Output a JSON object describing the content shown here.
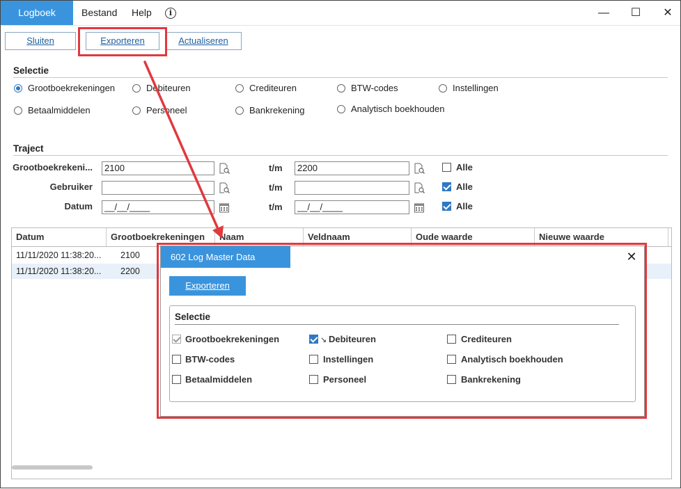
{
  "window": {
    "app_tab": "Logboek",
    "menu": [
      "Bestand",
      "Help"
    ],
    "controls": {
      "minimize": "—",
      "maximize": "☐",
      "close": "✕"
    }
  },
  "toolbar": {
    "sluiten": "Sluiten",
    "exporteren": "Exporteren",
    "actualiseren": "Actualiseren"
  },
  "selectie": {
    "title": "Selectie",
    "options": [
      {
        "label": "Grootboekrekeningen",
        "selected": true
      },
      {
        "label": "Debiteuren",
        "selected": false
      },
      {
        "label": "Crediteuren",
        "selected": false
      },
      {
        "label": "BTW-codes",
        "selected": false
      },
      {
        "label": "Instellingen",
        "selected": false
      },
      {
        "label": "Betaalmiddelen",
        "selected": false
      },
      {
        "label": "Personeel",
        "selected": false
      },
      {
        "label": "Bankrekening",
        "selected": false
      },
      {
        "label": "Analytisch boekhouden",
        "selected": false
      }
    ]
  },
  "traject": {
    "title": "Traject",
    "rows": [
      {
        "label": "Grootboekrekeni...",
        "from": "2100",
        "to_label": "t/m",
        "to": "2200",
        "alle_label": "Alle",
        "alle": false
      },
      {
        "label": "Gebruiker",
        "from": "",
        "to_label": "t/m",
        "to": "",
        "alle_label": "Alle",
        "alle": true
      },
      {
        "label": "Datum",
        "from": "__/__/____",
        "to_label": "t/m",
        "to": "__/__/____",
        "alle_label": "Alle",
        "alle": true
      }
    ]
  },
  "grid": {
    "columns": [
      "Datum",
      "Grootboekrekeningen",
      "Naam",
      "Veldnaam",
      "Oude waarde",
      "Nieuwe waarde"
    ],
    "rows": [
      [
        "11/11/2020 11:38:20...",
        "2100",
        "",
        "",
        "",
        ""
      ],
      [
        "11/11/2020 11:38:20...",
        "2200",
        "",
        "",
        "",
        ""
      ]
    ]
  },
  "dialog": {
    "title": "602 Log Master Data",
    "close": "✕",
    "export_button": "Exporteren",
    "group_title": "Selectie",
    "checks": [
      {
        "label": "Grootboekrekeningen",
        "state": "disabled-checked"
      },
      {
        "label": "Debiteuren",
        "state": "checked"
      },
      {
        "label": "Crediteuren",
        "state": "unchecked"
      },
      {
        "label": "BTW-codes",
        "state": "unchecked"
      },
      {
        "label": "Instellingen",
        "state": "unchecked"
      },
      {
        "label": "Analytisch boekhouden",
        "state": "unchecked"
      },
      {
        "label": "Betaalmiddelen",
        "state": "unchecked"
      },
      {
        "label": "Personeel",
        "state": "unchecked"
      },
      {
        "label": "Bankrekening",
        "state": "unchecked"
      }
    ]
  },
  "colors": {
    "accent": "#3a94dd",
    "highlight": "#e0393e",
    "row_alt": "#e8f0fa"
  }
}
